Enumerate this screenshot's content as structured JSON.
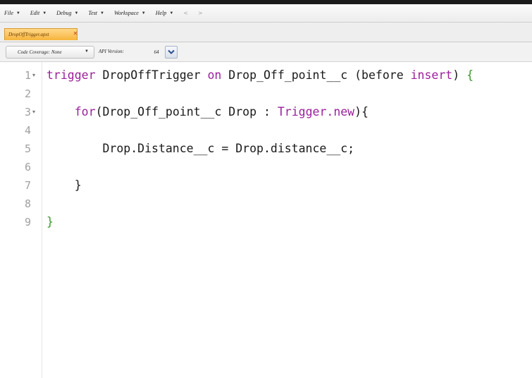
{
  "menu": [
    {
      "label": "File",
      "caret": "▼"
    },
    {
      "label": "Edit",
      "caret": "▼"
    },
    {
      "label": "Debug",
      "caret": "▼"
    },
    {
      "label": "Test",
      "caret": "▼"
    },
    {
      "label": "Workspace",
      "caret": "▼"
    },
    {
      "label": "Help",
      "caret": "▼"
    }
  ],
  "nav": {
    "back": "<",
    "forward": ">"
  },
  "tab": {
    "label": "DropOffTrigger.apxt",
    "close": "✕",
    "accent": "#f7b43c"
  },
  "toolbar": {
    "coverage_label": "Code Coverage: None",
    "coverage_caret": "▼",
    "api_label": "API Version:",
    "api_value": "64",
    "api_icon": "chevron-down-icon"
  },
  "editor": {
    "line_numbers": [
      "1",
      "2",
      "3",
      "4",
      "5",
      "6",
      "7",
      "8",
      "9"
    ],
    "fold_markers": {
      "1": "▾",
      "3": "▾"
    },
    "lines": [
      {
        "kw1": "trigger",
        "t1": " DropOffTrigger ",
        "kw2": "on",
        "t2": " Drop_Off_point__c (before ",
        "kw3": "insert",
        "t3": ") ",
        "brace": "{"
      },
      {},
      {
        "indent": "    ",
        "kw1": "for",
        "t1": "(Drop_Off_point__c Drop : ",
        "kw2": "Trigger.new",
        "t2": "){"
      },
      {},
      {
        "t1": "        Drop.Distance__c = Drop.distance__c;"
      },
      {},
      {
        "t1": "    }"
      },
      {},
      {
        "brace": "}"
      }
    ],
    "colors": {
      "keyword": "#9b1f9b",
      "brace": "#3a9a2a",
      "line_number": "#a0a0a0"
    }
  }
}
